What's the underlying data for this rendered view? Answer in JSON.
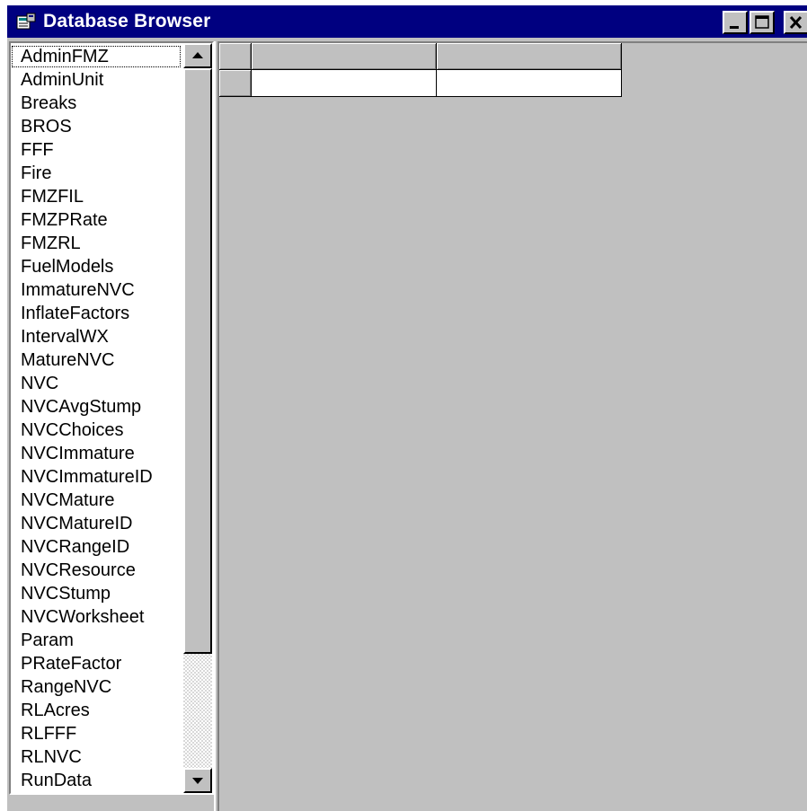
{
  "window": {
    "title": "Database Browser",
    "icon": "database-app-icon",
    "controls": [
      "minimize-icon",
      "maximize-icon",
      "close-icon"
    ]
  },
  "table_list": {
    "selected_index": 0,
    "items": [
      "AdminFMZ",
      "AdminUnit",
      "Breaks",
      "BROS",
      "FFF",
      "Fire",
      "FMZFIL",
      "FMZPRate",
      "FMZRL",
      "FuelModels",
      "ImmatureNVC",
      "InflateFactors",
      "IntervalWX",
      "MatureNVC",
      "NVC",
      "NVCAvgStump",
      "NVCChoices",
      "NVCImmature",
      "NVCImmatureID",
      "NVCMature",
      "NVCMatureID",
      "NVCRangeID",
      "NVCResource",
      "NVCStump",
      "NVCWorksheet",
      "Param",
      "PRateFactor",
      "RangeNVC",
      "RLAcres",
      "RLFFF",
      "RLNVC",
      "RunData"
    ],
    "scrollbar": {
      "up_icon": "scroll-up-arrow-icon",
      "down_icon": "scroll-down-arrow-icon"
    }
  },
  "data_grid": {
    "columns": [
      "",
      ""
    ],
    "rows": [
      [
        "",
        ""
      ]
    ]
  },
  "colors": {
    "title_bar": "#000080",
    "face": "#c0c0c0",
    "list_background": "#ffffff"
  }
}
